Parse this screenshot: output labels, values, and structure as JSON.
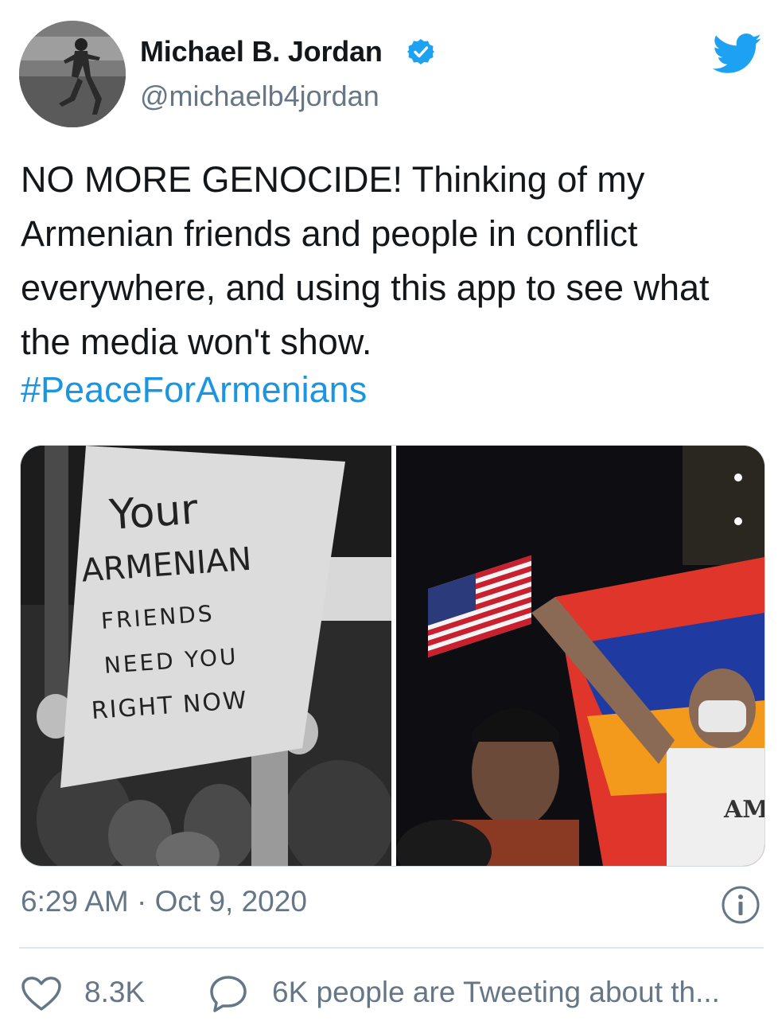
{
  "author": {
    "display_name": "Michael B. Jordan",
    "handle": "@michaelb4jordan",
    "verified": true,
    "avatar_icon": "profile-photo"
  },
  "platform_icon": "twitter-bird-icon",
  "tweet": {
    "text": "NO MORE GENOCIDE! Thinking of my Armenian friends and people in conflict everywhere, and using this app to see what the media won't show.",
    "hashtag": "#PeaceForArmenians"
  },
  "media": {
    "left_photo": {
      "sign_lines": [
        "Your",
        "ARMENIAN",
        "FRIENDS",
        "NEED YOU",
        "RIGHT NOW"
      ]
    },
    "right_photo": {
      "shirt_text": "AM"
    }
  },
  "meta": {
    "timestamp": "6:29 AM · Oct 9, 2020"
  },
  "actions": {
    "like_count": "8.3K",
    "conversation_text": "6K people are Tweeting about th..."
  },
  "colors": {
    "accent": "#1da1f2",
    "hashtag": "#1b95e0",
    "secondary_text": "#657786",
    "divider": "#e1e8ed"
  }
}
